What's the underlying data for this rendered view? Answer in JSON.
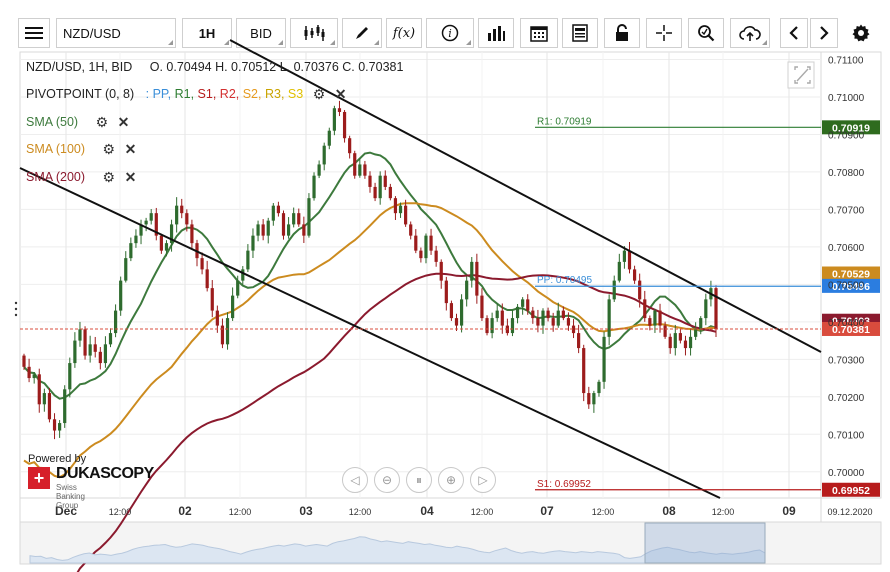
{
  "toolbar": {
    "symbol": "NZD/USD",
    "timeframe": "1H",
    "price_side": "BID",
    "buttons": [
      "menu-icon",
      "candles-icon",
      "draw-icon",
      "fx-icon",
      "info-icon",
      "bars-icon",
      "calendar-icon",
      "report-icon",
      "lock-icon",
      "crosshair-icon",
      "zoom-icon",
      "upload-icon",
      "prev-icon",
      "next-icon",
      "settings-icon"
    ],
    "fx_label": "f(x)"
  },
  "legend": {
    "ohlc_line": "NZD/USD, 1H, BID",
    "ohlc_values": "O. 0.70494  H. 0.70512  L. 0.70376  C. 0.70381",
    "pivot_label": "PIVOTPOINT (0, 8)",
    "pivot_sep": ":",
    "pivot_items": [
      {
        "label": "PP,",
        "color": "#3a8ed8"
      },
      {
        "label": "R1,",
        "color": "#2e7d32"
      },
      {
        "label": "S1,",
        "color": "#b71c1c"
      },
      {
        "label": "R2,",
        "color": "#d32f2f"
      },
      {
        "label": "S2,",
        "color": "#e69a1e"
      },
      {
        "label": "R3,",
        "color": "#c9a400"
      },
      {
        "label": "S3",
        "color": "#e0c000"
      }
    ],
    "sma": [
      {
        "label": "SMA (50)",
        "color": "#3d7a3d"
      },
      {
        "label": "SMA (100)",
        "color": "#cc8b1f"
      },
      {
        "label": "SMA (200)",
        "color": "#8b1a2e"
      }
    ]
  },
  "chart_data": {
    "type": "candlestick",
    "symbol": "NZD/USD",
    "interval": "1H",
    "ylim": [
      0.6993,
      0.7112
    ],
    "y_ticks": [
      "0.71100",
      "0.71000",
      "0.70900",
      "0.70800",
      "0.70700",
      "0.70600",
      "0.70500",
      "0.70400",
      "0.70300",
      "0.70200",
      "0.70100",
      "0.70000"
    ],
    "x_labels": [
      "Dec",
      "12:00",
      "02",
      "12:00",
      "03",
      "12:00",
      "04",
      "12:00",
      "07",
      "12:00",
      "08",
      "12:00",
      "09",
      "09.12.2020"
    ],
    "bold_x_labels": [
      "Dec",
      "02",
      "03",
      "04",
      "07",
      "08",
      "09"
    ],
    "price_tags": [
      {
        "label": "0.70919",
        "value": 0.70919,
        "color": "#2e6b1e"
      },
      {
        "label": "0.70529",
        "value": 0.70529,
        "color": "#cc8b1f"
      },
      {
        "label": "0.70496",
        "value": 0.70496,
        "color": "#2b7de0"
      },
      {
        "label": "0.70403",
        "value": 0.70403,
        "color": "#8b1a2e"
      },
      {
        "label": "0.70381",
        "value": 0.70381,
        "color": "#d94c3d"
      },
      {
        "label": "0.69952",
        "value": 0.69952,
        "color": "#b71c1c"
      }
    ],
    "pivot_levels": [
      {
        "name": "R1",
        "label": "R1: 0.70919",
        "value": 0.70919,
        "color": "#2e7d32"
      },
      {
        "name": "PP",
        "label": "PP: 0.70495",
        "value": 0.70495,
        "color": "#3a8ed8"
      },
      {
        "name": "S1",
        "label": "S1: 0.69952",
        "value": 0.69952,
        "color": "#b71c1c"
      }
    ],
    "current_price": 0.70381,
    "candles_close": [
      0.7028,
      0.7025,
      0.7026,
      0.7018,
      0.7021,
      0.7014,
      0.7011,
      0.7013,
      0.7022,
      0.7029,
      0.7035,
      0.7038,
      0.7031,
      0.7034,
      0.7032,
      0.7029,
      0.7034,
      0.7037,
      0.7043,
      0.7051,
      0.7057,
      0.7061,
      0.7063,
      0.7066,
      0.7067,
      0.7069,
      0.7063,
      0.7059,
      0.7061,
      0.7066,
      0.7071,
      0.7069,
      0.7066,
      0.7061,
      0.7057,
      0.7054,
      0.7049,
      0.7043,
      0.7039,
      0.7034,
      0.7041,
      0.7047,
      0.7051,
      0.7054,
      0.7059,
      0.7063,
      0.7066,
      0.7063,
      0.7067,
      0.7071,
      0.7069,
      0.7063,
      0.7066,
      0.7069,
      0.7066,
      0.7063,
      0.7073,
      0.7079,
      0.7082,
      0.7087,
      0.7091,
      0.7097,
      0.7096,
      0.7089,
      0.7085,
      0.7079,
      0.7082,
      0.7079,
      0.7076,
      0.7073,
      0.7079,
      0.7076,
      0.7073,
      0.7069,
      0.7071,
      0.7066,
      0.7063,
      0.7059,
      0.7057,
      0.7063,
      0.7059,
      0.7056,
      0.7051,
      0.7045,
      0.7041,
      0.7039,
      0.7046,
      0.7051,
      0.7056,
      0.7047,
      0.7041,
      0.7037,
      0.7041,
      0.7043,
      0.7039,
      0.7037,
      0.7041,
      0.7044,
      0.7046,
      0.7043,
      0.7041,
      0.7039,
      0.7043,
      0.7041,
      0.7039,
      0.7043,
      0.7041,
      0.7039,
      0.7037,
      0.7033,
      0.7021,
      0.7018,
      0.7021,
      0.7024,
      0.7036,
      0.7046,
      0.7051,
      0.7056,
      0.7059,
      0.7054,
      0.7051,
      0.7046,
      0.7041,
      0.7039,
      0.7043,
      0.7039,
      0.7036,
      0.7033,
      0.7037,
      0.7035,
      0.7033,
      0.7036,
      0.7038,
      0.7041,
      0.7046,
      0.7049,
      0.7038
    ]
  },
  "navigator": {
    "buttons": [
      "nav-left-icon",
      "zoom-out-icon",
      "reset-icon",
      "zoom-in-icon",
      "nav-right-icon"
    ]
  },
  "branding": {
    "powered": "Powered by",
    "name": "DUKASCOPY",
    "sub": "Swiss Banking Group"
  }
}
